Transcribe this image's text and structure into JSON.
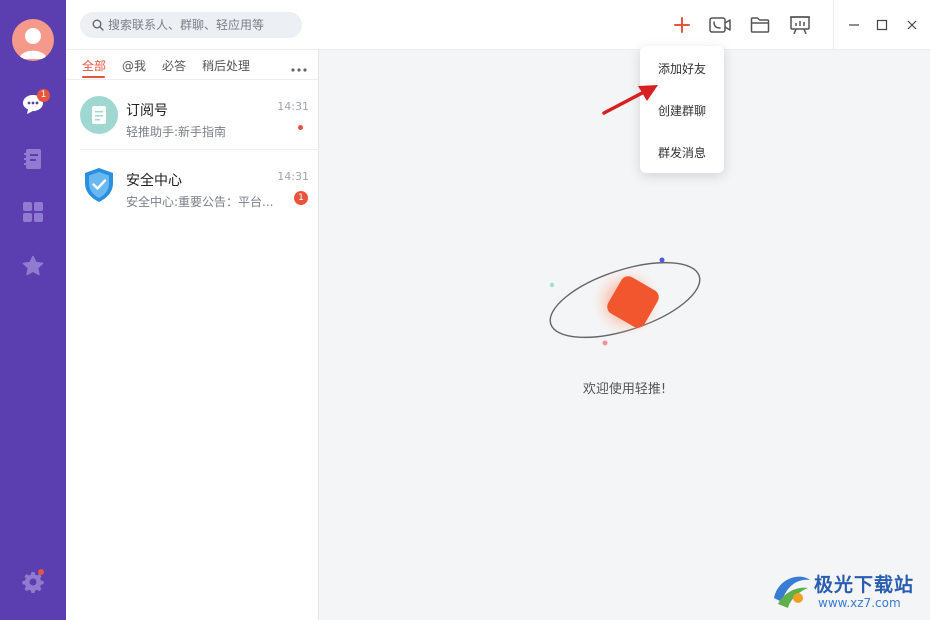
{
  "search": {
    "placeholder": "搜索联系人、群聊、轻应用等"
  },
  "sidebar": {
    "messages_badge": "1"
  },
  "tabs": [
    {
      "label": "全部",
      "active": true
    },
    {
      "label": "@我"
    },
    {
      "label": "必答"
    },
    {
      "label": "稍后处理"
    }
  ],
  "conversations": [
    {
      "title": "订阅号",
      "subtitle": "轻推助手:新手指南",
      "time": "14:31",
      "unread_dot": true
    },
    {
      "title": "安全中心",
      "subtitle": "安全中心:重要公告：平台...",
      "time": "14:31",
      "badge": "1"
    }
  ],
  "menu": {
    "items": [
      "添加好友",
      "创建群聊",
      "群发消息"
    ]
  },
  "main": {
    "welcome_text": "欢迎使用轻推!"
  },
  "watermark": {
    "name": "极光下载站",
    "url": "www.xz7.com"
  },
  "colors": {
    "rail": "#5b3fb0",
    "accent": "#e8553e",
    "text": "#333333"
  }
}
